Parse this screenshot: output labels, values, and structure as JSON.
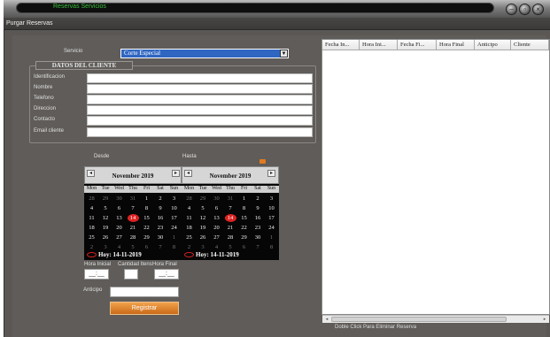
{
  "window": {
    "title": "Reservas Servicios"
  },
  "menu": {
    "tab": "Purgar Reservas"
  },
  "form": {
    "servicio_label": "Servicio",
    "servicio_value": "Corte Especial",
    "group_title": "DATOS DEL CLIENTE",
    "fields": [
      {
        "label": "Identificacion"
      },
      {
        "label": "Nombre"
      },
      {
        "label": "Telefono"
      },
      {
        "label": "Direccion"
      },
      {
        "label": "Contacto"
      },
      {
        "label": "Email cliente"
      }
    ],
    "desde_label": "Desde",
    "hasta_label": "Hasta",
    "hora_inicial_label": "Hora Inicial",
    "cantidad_label": "Cantidad Itens",
    "hora_final_label": "Hora Final",
    "hora_inicial_value": "__:__",
    "hora_final_value": "__:__",
    "anticipo_label": "Anticipo",
    "registrar_label": "Registrar"
  },
  "calendars": [
    {
      "month": "November 2019",
      "dow": [
        "Mon",
        "Tue",
        "Wed",
        "Thu",
        "Fri",
        "Sat",
        "Sun"
      ],
      "weeks": [
        [
          "28",
          "29",
          "30",
          "31",
          "1",
          "2",
          "3"
        ],
        [
          "4",
          "5",
          "6",
          "7",
          "8",
          "9",
          "10"
        ],
        [
          "11",
          "12",
          "13",
          "14",
          "15",
          "16",
          "17"
        ],
        [
          "18",
          "19",
          "20",
          "21",
          "22",
          "23",
          "24"
        ],
        [
          "25",
          "26",
          "27",
          "28",
          "29",
          "30",
          "1"
        ],
        [
          "2",
          "3",
          "4",
          "5",
          "6",
          "7",
          "8"
        ]
      ],
      "today_label": "Hoy: 14-11-2019"
    },
    {
      "month": "November 2019",
      "dow": [
        "Mon",
        "Tue",
        "Wed",
        "Thu",
        "Fri",
        "Sat",
        "Sun"
      ],
      "weeks": [
        [
          "28",
          "29",
          "30",
          "31",
          "1",
          "2",
          "3"
        ],
        [
          "4",
          "5",
          "6",
          "7",
          "8",
          "9",
          "10"
        ],
        [
          "11",
          "12",
          "13",
          "14",
          "15",
          "16",
          "17"
        ],
        [
          "18",
          "19",
          "20",
          "21",
          "22",
          "23",
          "24"
        ],
        [
          "25",
          "26",
          "27",
          "28",
          "29",
          "30",
          "1"
        ],
        [
          "2",
          "3",
          "4",
          "5",
          "6",
          "7",
          "8"
        ]
      ],
      "today_label": "Hoy: 14-11-2019"
    }
  ],
  "table": {
    "columns": [
      "Fecha In...",
      "Hora Ini...",
      "Fecha Fi...",
      "Hora Final",
      "Anticipo",
      "Cliente"
    ]
  },
  "hint": "Doble Click Para Eliminar Reserva",
  "icons": {
    "minimize": "minimize-icon",
    "restore": "restore-icon",
    "close": "close-icon"
  }
}
